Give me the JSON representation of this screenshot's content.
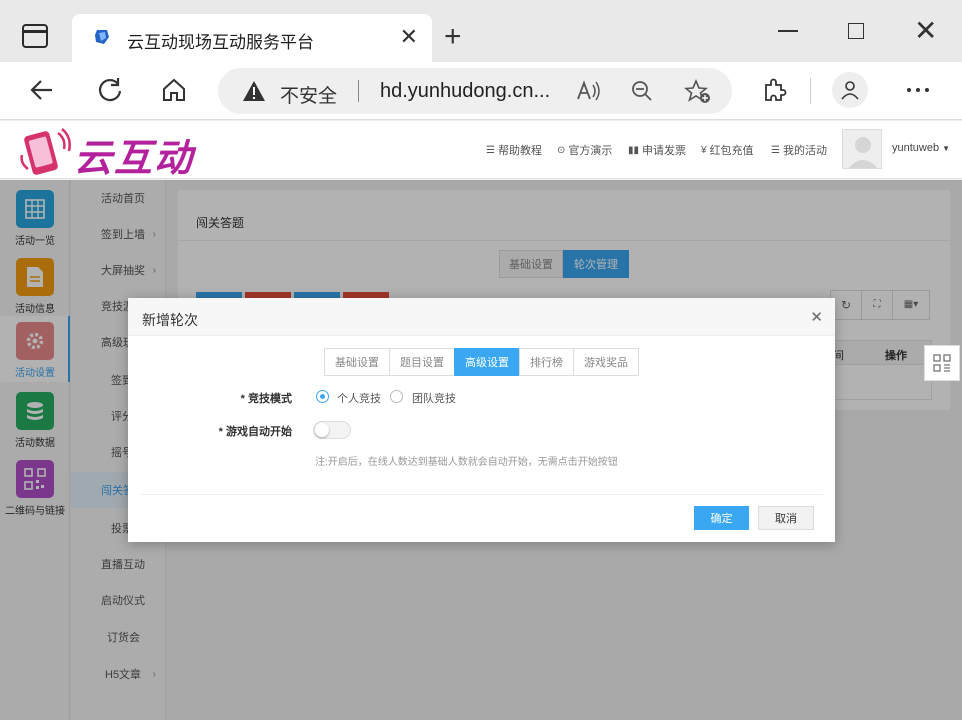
{
  "browser": {
    "tab_title": "云互动现场互动服务平台",
    "security_label": "不安全",
    "url": "hd.yunhudong.cn..."
  },
  "header": {
    "logo_text": "云互动",
    "nav": [
      {
        "icon": "list-icon",
        "label": "帮助教程"
      },
      {
        "icon": "play-circle-icon",
        "label": "官方演示"
      },
      {
        "icon": "card-icon",
        "label": "申请发票"
      },
      {
        "icon": "yen-icon",
        "label": "红包充值"
      },
      {
        "icon": "list-icon",
        "label": "我的活动"
      }
    ],
    "username": "yuntuweb"
  },
  "rail": [
    {
      "label": "活动一览",
      "color": "#29a7e1",
      "icon": "grid-icon"
    },
    {
      "label": "活动信息",
      "color": "#f39c12",
      "icon": "document-icon"
    },
    {
      "label": "活动设置",
      "color": "#e88a8a",
      "icon": "gear-icon"
    },
    {
      "label": "活动数据",
      "color": "#27ae60",
      "icon": "database-icon"
    },
    {
      "label": "二维码与链接",
      "color": "#b04fc7",
      "icon": "qrcode-icon"
    }
  ],
  "submenu": [
    {
      "label": "活动首页",
      "arrow": ""
    },
    {
      "label": "签到上墙",
      "arrow": "›"
    },
    {
      "label": "大屏抽奖",
      "arrow": "›"
    },
    {
      "label": "竞技游",
      "arrow": ""
    },
    {
      "label": "高级玩",
      "arrow": ""
    },
    {
      "label": "签到",
      "arrow": ""
    },
    {
      "label": "评分",
      "arrow": ""
    },
    {
      "label": "摇号",
      "arrow": ""
    },
    {
      "label": "闯关答",
      "arrow": ""
    },
    {
      "label": "投票",
      "arrow": ""
    },
    {
      "label": "直播互动",
      "arrow": ""
    },
    {
      "label": "启动仪式",
      "arrow": ""
    },
    {
      "label": "订货会",
      "arrow": ""
    },
    {
      "label": "H5文章",
      "arrow": "›"
    }
  ],
  "main": {
    "panel_title": "闯关答题",
    "seg_basic": "基础设置",
    "seg_rounds": "轮次管理",
    "table_col_a": "间",
    "table_col_ops": "操作"
  },
  "modal": {
    "title": "新增轮次",
    "tabs": [
      "基础设置",
      "题目设置",
      "高级设置",
      "排行榜",
      "游戏奖品"
    ],
    "active_tab": "高级设置",
    "mode_label": "* 竞技模式",
    "mode_individual": "个人竞技",
    "mode_team": "团队竞技",
    "mode_selected": "个人竞技",
    "auto_label": "* 游戏自动开始",
    "auto_on": false,
    "note": "注:开启后，在线人数达到基础人数就会自动开始，无需点击开始按钮",
    "ok": "确定",
    "cancel": "取消"
  }
}
